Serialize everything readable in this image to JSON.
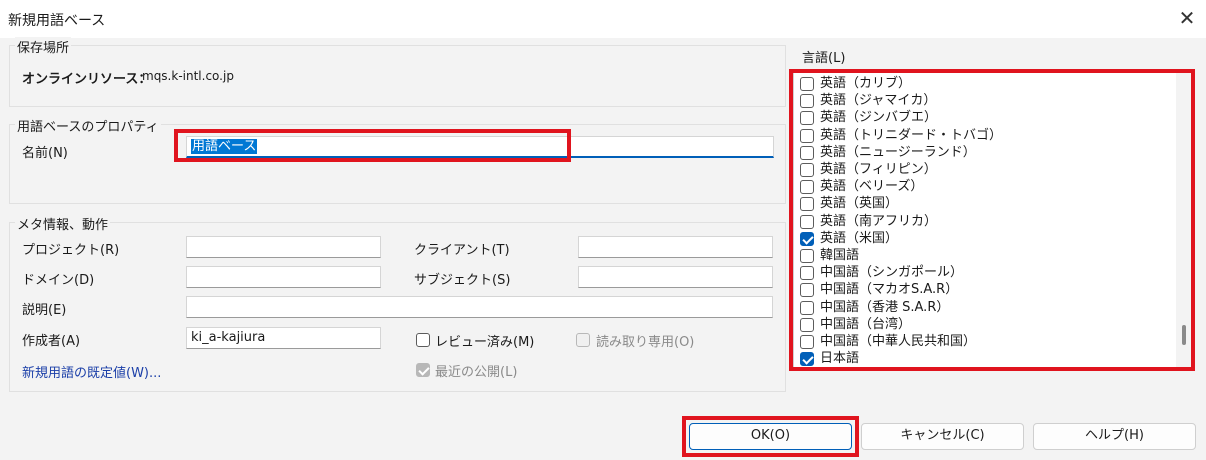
{
  "dialog": {
    "title": "新規用語ベース",
    "close_glyph": "✕"
  },
  "storage": {
    "group_label": "保存場所",
    "online_label": "オンラインリソース：",
    "server": "mqs.k-intl.co.jp"
  },
  "props": {
    "group_label": "用語ベースのプロパティ",
    "name_label": "名前(N)",
    "name_value": "用語ベース"
  },
  "meta": {
    "group_label": "メタ情報、動作",
    "project_label": "プロジェクト(R)",
    "project_value": "",
    "client_label": "クライアント(T)",
    "client_value": "",
    "domain_label": "ドメイン(D)",
    "domain_value": "",
    "subject_label": "サブジェクト(S)",
    "subject_value": "",
    "description_label": "説明(E)",
    "description_value": "",
    "author_label": "作成者(A)",
    "author_value": "ki_a-kajiura",
    "reviewed_label": "レビュー済み(M)",
    "reviewed_checked": false,
    "readonly_label": "読み取り専用(O)",
    "readonly_checked": false,
    "defaults_link": "新規用語の既定値(W)...",
    "recent_label": "最近の公開(L)",
    "recent_checked": true
  },
  "languages": {
    "label": "言語(L)",
    "items": [
      {
        "label": "英語（カリブ）",
        "checked": false
      },
      {
        "label": "英語（ジャマイカ）",
        "checked": false
      },
      {
        "label": "英語（ジンバブエ）",
        "checked": false
      },
      {
        "label": "英語（トリニダード・トバゴ）",
        "checked": false
      },
      {
        "label": "英語（ニュージーランド）",
        "checked": false
      },
      {
        "label": "英語（フィリピン）",
        "checked": false
      },
      {
        "label": "英語（ベリーズ）",
        "checked": false
      },
      {
        "label": "英語（英国）",
        "checked": false
      },
      {
        "label": "英語（南アフリカ）",
        "checked": false
      },
      {
        "label": "英語（米国）",
        "checked": true
      },
      {
        "label": "韓国語",
        "checked": false
      },
      {
        "label": "中国語（シンガポール）",
        "checked": false
      },
      {
        "label": "中国語（マカオS.A.R）",
        "checked": false
      },
      {
        "label": "中国語（香港 S.A.R）",
        "checked": false
      },
      {
        "label": "中国語（台湾）",
        "checked": false
      },
      {
        "label": "中国語（中華人民共和国）",
        "checked": false
      },
      {
        "label": "日本語",
        "checked": true
      }
    ]
  },
  "buttons": {
    "ok": "OK(O)",
    "cancel": "キャンセル(C)",
    "help": "ヘルプ(H)"
  },
  "colors": {
    "highlight": "#e0141e",
    "accent": "#005fb8",
    "link": "#1b3fa8"
  }
}
